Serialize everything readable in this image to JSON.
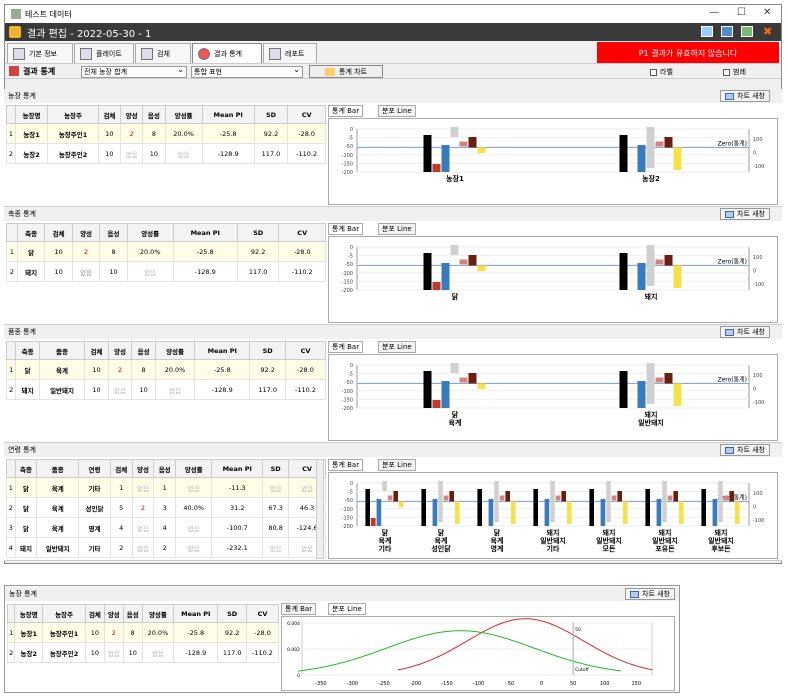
{
  "window": {
    "title": "테스트 데이터",
    "edit_title": "결과 편집 - 2022-05-30 - 1"
  },
  "tabs": [
    {
      "label": "기본 정보"
    },
    {
      "label": "플레이트"
    },
    {
      "label": "검체"
    },
    {
      "label": "결과 통계"
    },
    {
      "label": "레포트"
    }
  ],
  "warning": "P1 결과가 유효하지 않습니다",
  "toolbar": {
    "section_label": "결과 통계",
    "group_select": "전체 농장 합계",
    "expr_select": "통합 표현",
    "chart_btn": "통계 차트",
    "label_chk": "라벨",
    "legend_chk": "범례"
  },
  "chart_tabs": {
    "bar": "통계 Bar",
    "line": "분포 Line"
  },
  "new_chart": "차트 새창",
  "zero_label": "Zero(통계)",
  "farm": {
    "title": "농장 통계",
    "headers": [
      "농장명",
      "농장주",
      "검체",
      "양성",
      "음성",
      "양성률",
      "Mean PI",
      "SD",
      "CV"
    ],
    "rows": [
      [
        "농장1",
        "농장주인1",
        "10",
        "2",
        "8",
        "20.0%",
        "-25.8",
        "92.2",
        "-28.0"
      ],
      [
        "농장2",
        "농장주인2",
        "10",
        "없음",
        "10",
        "없음",
        "-128.9",
        "117.0",
        "-110.2"
      ]
    ],
    "cats": [
      "농장1",
      "농장2"
    ]
  },
  "species": {
    "title": "축종 통계",
    "headers": [
      "축종",
      "검체",
      "양성",
      "음성",
      "양성률",
      "Mean PI",
      "SD",
      "CV"
    ],
    "rows": [
      [
        "닭",
        "10",
        "2",
        "8",
        "20.0%",
        "-25.8",
        "92.2",
        "-28.0"
      ],
      [
        "돼지",
        "10",
        "없음",
        "10",
        "없음",
        "-128.9",
        "117.0",
        "-110.2"
      ]
    ],
    "cats": [
      "닭",
      "돼지"
    ]
  },
  "breed": {
    "title": "품종 통계",
    "headers": [
      "축종",
      "품종",
      "검체",
      "양성",
      "음성",
      "양성률",
      "Mean PI",
      "SD",
      "CV"
    ],
    "rows": [
      [
        "닭",
        "육계",
        "10",
        "2",
        "8",
        "20.0%",
        "-25.8",
        "92.2",
        "-28.0"
      ],
      [
        "돼지",
        "일반돼지",
        "10",
        "없음",
        "10",
        "없음",
        "-128.9",
        "117.0",
        "-110.2"
      ]
    ],
    "cats": [
      "닭\n육계",
      "돼지\n일반돼지"
    ]
  },
  "age": {
    "title": "연령 통계",
    "headers": [
      "축종",
      "품종",
      "연령",
      "검체",
      "양성",
      "음성",
      "양성률",
      "Mean PI",
      "SD",
      "CV"
    ],
    "rows": [
      [
        "닭",
        "육계",
        "기타",
        "1",
        "없음",
        "1",
        "없음",
        "-11.3",
        "없음",
        "없음"
      ],
      [
        "닭",
        "육계",
        "성인닭",
        "5",
        "2",
        "3",
        "40.0%",
        "31.2",
        "67.3",
        "46.3"
      ],
      [
        "닭",
        "육계",
        "영계",
        "4",
        "없음",
        "4",
        "없음",
        "-100.7",
        "80.8",
        "-124.6"
      ],
      [
        "돼지",
        "일반돼지",
        "기타",
        "2",
        "없음",
        "2",
        "없음",
        "-232.1",
        "없음",
        "없음"
      ]
    ],
    "cats": [
      "닭\n육계\n기타",
      "닭\n육계\n성인닭",
      "닭\n육계\n영계",
      "돼지\n일반돼지\n기타",
      "돼지\n일반돼지\n모돈",
      "돼지\n일반돼지\n포유돈",
      "돼지\n일반돼지\n후보돈"
    ],
    "zero_label": "Zero(통계)"
  },
  "farm2": {
    "title": "농장 통계",
    "headers": [
      "농장명",
      "농장주",
      "검체",
      "양성",
      "음성",
      "양성률",
      "Mean PI",
      "SD",
      "CV"
    ],
    "rows": [
      [
        "농장1",
        "농장주인1",
        "10",
        "2",
        "8",
        "20.0%",
        "-25.8",
        "92.2",
        "-28.0"
      ],
      [
        "농장2",
        "농장주인2",
        "10",
        "없음",
        "10",
        "없음",
        "-128.9",
        "117.0",
        "-110.2"
      ]
    ]
  },
  "chart_data": [
    {
      "type": "bar",
      "title": "농장 통계 Bar",
      "categories": [
        "농장1",
        "농장2"
      ],
      "left_axis": {
        "ticks": [
          "0",
          "-5",
          "-50",
          "-100",
          "-150",
          "-200"
        ]
      },
      "right_axis": {
        "ticks": [
          "100",
          "0",
          "-100"
        ]
      },
      "series": [
        {
          "values": [
            10,
            10
          ],
          "color": "#000000"
        },
        {
          "values": [
            2,
            0
          ],
          "color": "#c0392b"
        },
        {
          "values": [
            8,
            10
          ],
          "color": "#3a7bbf"
        },
        {
          "values": [
            20,
            0
          ],
          "color": "#d0d0d0"
        },
        {
          "values": [
            -25.8,
            -128.9
          ],
          "color": "#d98080"
        },
        {
          "values": [
            92.2,
            117.0
          ],
          "color": "#6b1e0e"
        },
        {
          "values": [
            -28.0,
            -110.2
          ],
          "color": "#f5e14a"
        }
      ]
    },
    {
      "type": "line",
      "title": "분포 Line",
      "x": [
        -350,
        -300,
        -250,
        -200,
        -150,
        -100,
        -50,
        0,
        50,
        100,
        150
      ],
      "ylim": [
        0,
        0.004
      ],
      "y_ticks": [
        "0.004",
        "0.002",
        "0"
      ],
      "series": [
        {
          "mean": -25.8,
          "sd": 92.2,
          "color": "#d62828"
        },
        {
          "mean": -128.9,
          "sd": 117.0,
          "color": "#22bb22"
        }
      ],
      "annotations": [
        "50",
        "Cutoff"
      ]
    }
  ]
}
